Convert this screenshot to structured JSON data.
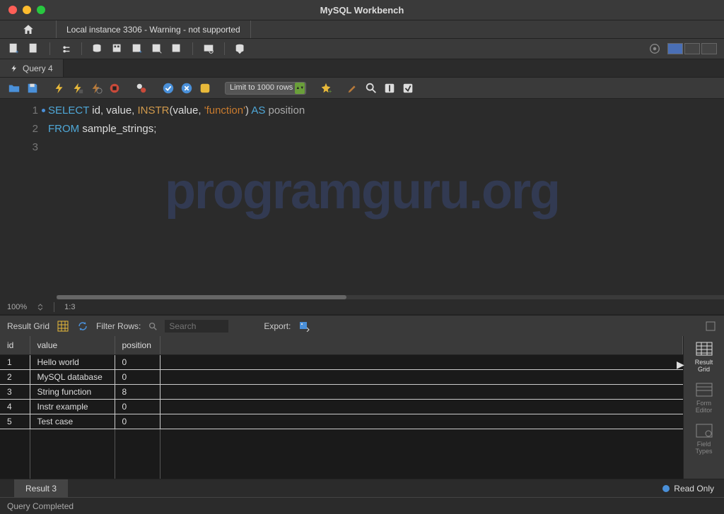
{
  "window": {
    "title": "MySQL Workbench"
  },
  "connection_tab": "Local instance 3306 - Warning - not supported",
  "query_tab": "Query 4",
  "limit_select": "Limit to 1000 rows",
  "editor": {
    "lines": [
      {
        "n": "1",
        "marked": true,
        "tokens": [
          {
            "t": "SELECT",
            "c": "kw"
          },
          {
            "t": " ",
            "c": ""
          },
          {
            "t": "id",
            "c": "ident"
          },
          {
            "t": ", ",
            "c": "punct"
          },
          {
            "t": "value",
            "c": "ident"
          },
          {
            "t": ", ",
            "c": "punct"
          },
          {
            "t": "INSTR",
            "c": "fn"
          },
          {
            "t": "(",
            "c": "punct"
          },
          {
            "t": "value",
            "c": "ident"
          },
          {
            "t": ", ",
            "c": "punct"
          },
          {
            "t": "'function'",
            "c": "str"
          },
          {
            "t": ")",
            "c": "punct"
          },
          {
            "t": " ",
            "c": ""
          },
          {
            "t": "AS",
            "c": "kw"
          },
          {
            "t": " ",
            "c": ""
          },
          {
            "t": "position",
            "c": "asword"
          }
        ]
      },
      {
        "n": "2",
        "marked": false,
        "tokens": [
          {
            "t": "FROM",
            "c": "kw"
          },
          {
            "t": " ",
            "c": ""
          },
          {
            "t": "sample_strings",
            "c": "ident"
          },
          {
            "t": ";",
            "c": "punct"
          }
        ]
      },
      {
        "n": "3",
        "marked": false,
        "active": true,
        "tokens": []
      }
    ],
    "zoom": "100%",
    "cursor": "1:3"
  },
  "result_toolbar": {
    "label": "Result Grid",
    "filter_label": "Filter Rows:",
    "search_placeholder": "Search",
    "export_label": "Export:"
  },
  "results": {
    "columns": [
      "id",
      "value",
      "position"
    ],
    "rows": [
      [
        "1",
        "Hello world",
        "0"
      ],
      [
        "2",
        "MySQL database",
        "0"
      ],
      [
        "3",
        "String function",
        "8"
      ],
      [
        "4",
        "Instr example",
        "0"
      ],
      [
        "5",
        "Test case",
        "0"
      ]
    ]
  },
  "side_buttons": {
    "result_grid": "Result\nGrid",
    "form_editor": "Form\nEditor",
    "field_types": "Field\nTypes"
  },
  "result_tab": "Result 3",
  "readonly_label": "Read Only",
  "status": "Query Completed",
  "watermark": "programguru.org"
}
